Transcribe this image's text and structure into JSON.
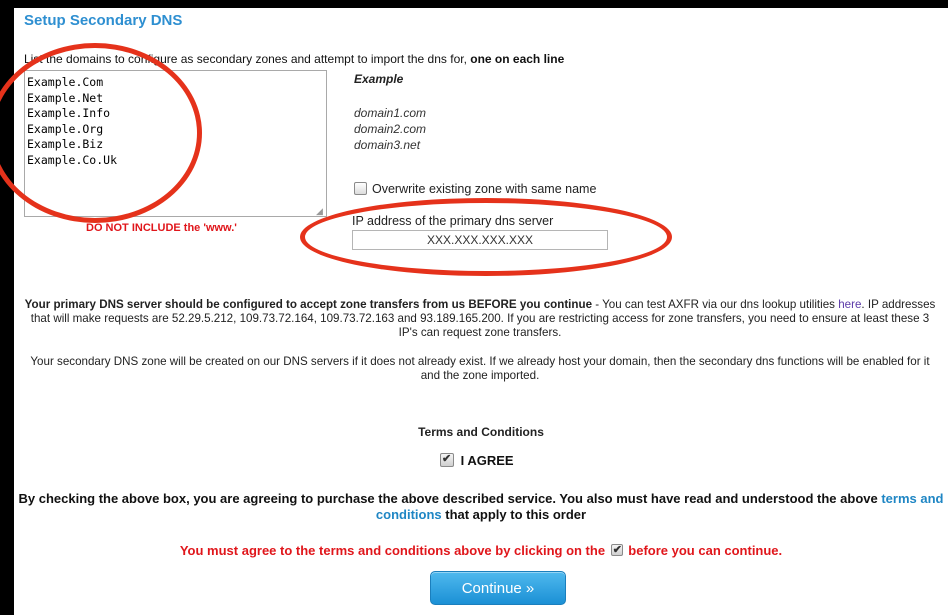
{
  "title": "Setup Secondary DNS",
  "instructions": {
    "text": "List the domains to configure as secondary zones and attempt to import the dns for, ",
    "bold": "one on each line"
  },
  "domains_textarea": {
    "value": "Example.Com\nExample.Net\nExample.Info\nExample.Org\nExample.Biz\nExample.Co.Uk"
  },
  "warning": "DO NOT INCLUDE the 'www.'",
  "example": {
    "heading": "Example",
    "items": [
      "domain1.com",
      "domain2.com",
      "domain3.net"
    ]
  },
  "overwrite": {
    "label": "Overwrite existing zone with same name",
    "checked": false
  },
  "primary_ip": {
    "label": "IP address of the primary dns server",
    "value": "XXX.XXX.XXX.XXX"
  },
  "info": {
    "p1_bold": "Your primary DNS server should be configured to accept zone transfers from us BEFORE you continue",
    "p1_part1": " - You can test AXFR via our dns lookup utilities ",
    "p1_link": "here",
    "p1_part2": ". IP addresses that will make requests are 52.29.5.212, 109.73.72.164, 109.73.72.163 and 93.189.165.200. If you are restricting access for zone transfers, you need to ensure at least these 3 IP's can request zone transfers.",
    "p2": "Your secondary DNS zone will be created on our DNS servers if it does not already exist. If we already host your domain, then the secondary dns functions will be enabled for it and the zone imported."
  },
  "terms": {
    "heading": "Terms and Conditions",
    "agree_label": "I AGREE",
    "agree_checked": true,
    "legal_part1": "By checking the above box, you are agreeing to purchase the above described service. You also must have read and understood the above ",
    "legal_link": "terms and conditions",
    "legal_part2": " that apply to this order",
    "must_part1": "You must agree to the terms and conditions above by clicking on the ",
    "must_part2": " before you can continue."
  },
  "continue_button": "Continue »",
  "colors": {
    "title": "#2e8fd1",
    "warning": "#e0161b",
    "link": "#1f86c4",
    "annotation": "#e5321b",
    "button": "#1b90d5"
  }
}
